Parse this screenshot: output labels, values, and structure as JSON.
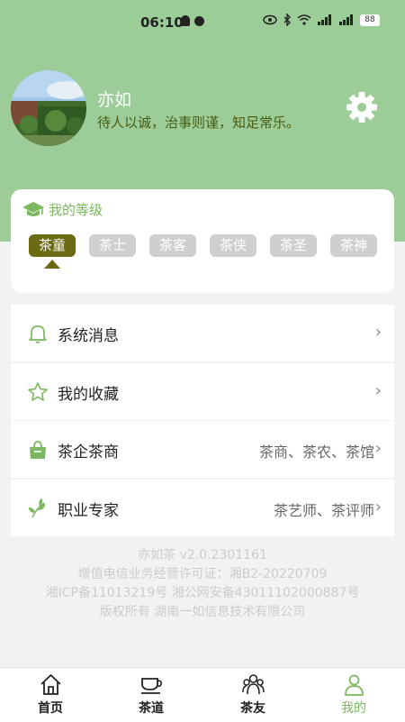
{
  "status_bar": {
    "time": "06:10",
    "battery": "88"
  },
  "profile": {
    "name": "亦如",
    "motto": "待人以诚，治事则谨，知足常乐。",
    "settings_icon": "gear-icon"
  },
  "level": {
    "title": "我的等级",
    "tags": [
      "茶童",
      "茶士",
      "茶客",
      "茶侠",
      "茶圣",
      "茶神"
    ],
    "current_index": 0
  },
  "menu": [
    {
      "label": "系统消息",
      "value": "",
      "icon": "bell-icon"
    },
    {
      "label": "我的收藏",
      "value": "",
      "icon": "star-icon"
    },
    {
      "label": "茶企茶商",
      "value": "茶商、茶农、茶馆",
      "icon": "shopping-bag-icon"
    },
    {
      "label": "职业专家",
      "value": "茶艺师、茶评师",
      "icon": "leaf-icon"
    }
  ],
  "footer": {
    "version": "亦如茶 v2.0.2301161",
    "license": "增值电信业务经营许可证：湘B2-20220709",
    "icp": "湘ICP备11013219号 湘公网安备43011102000887号",
    "copyright": "版权所有 湖南一如信息技术有限公司"
  },
  "tabs": [
    {
      "label": "首页",
      "icon": "home-icon"
    },
    {
      "label": "茶道",
      "icon": "teacup-icon"
    },
    {
      "label": "茶友",
      "icon": "group-icon"
    },
    {
      "label": "我的",
      "icon": "user-icon"
    }
  ],
  "active_tab": 3,
  "colors": {
    "header": "#9ccc98",
    "accent": "#7bb85f",
    "level_active": "#6a6a12",
    "level_inactive": "#cfcfcf"
  }
}
